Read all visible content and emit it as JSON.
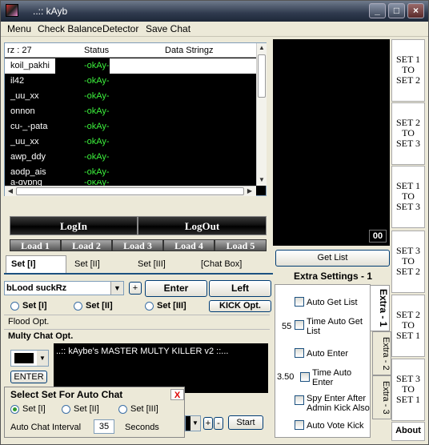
{
  "window": {
    "title": "..:: kAyb"
  },
  "menu": [
    "Menu",
    "Check Balance",
    "Detector",
    "Save Chat"
  ],
  "list": {
    "headers": {
      "count": "rz : 27",
      "status": "Status",
      "data": "Data Stringz"
    },
    "rows": [
      {
        "name": "koil_pakhi",
        "status": "-okAy-"
      },
      {
        "name": "il42",
        "status": "-okAy-"
      },
      {
        "name": "_uu_xx",
        "status": "-okAy-"
      },
      {
        "name": "onnon",
        "status": "-okAy-"
      },
      {
        "name": "cu-_-pata",
        "status": "-okAy-"
      },
      {
        "name": "_uu_xx",
        "status": "-okAy-"
      },
      {
        "name": "awp_ddy",
        "status": "-okAy-"
      },
      {
        "name": "aodp_ais",
        "status": "-okAy-"
      },
      {
        "name": "a-dvbnq",
        "status": "-okAy-"
      }
    ]
  },
  "buttons": {
    "login": "LogIn",
    "logout": "LogOut",
    "enter": "Enter",
    "left": "Left",
    "kick": "KICK Opt.",
    "get_list": "Get List",
    "start": "Start",
    "enter_small": "ENTER",
    "about": "About"
  },
  "loads": [
    "Load 1",
    "Load 2",
    "Load 3",
    "Load 4",
    "Load 5"
  ],
  "set_tabs": [
    "Set [I]",
    "Set [II]",
    "Set [III]",
    "[Chat Box]"
  ],
  "room": {
    "value": "bLood suckRz"
  },
  "set_radios": [
    "Set [I]",
    "Set [II]",
    "Set [III]"
  ],
  "flood_label": "Flood Opt.",
  "multy_label": "Multy Chat Opt.",
  "chat_text": "..:: kAybe's MASTER MULTY KILLER v2 ::...",
  "monitor_counter": "00",
  "extra": {
    "title": "Extra Settings - 1",
    "auto_get_list": "Auto Get List",
    "time_get_list_value": "55",
    "time_get_list": "Time Auto Get List",
    "auto_enter": "Auto Enter",
    "time_enter_value": "3.50",
    "time_enter": "Time  Auto Enter",
    "spy_enter": "Spy Enter After Admin Kick Also",
    "auto_vote": "Auto Vote Kick",
    "tabs": [
      "Extra - 1",
      "Extra - 2",
      "Extra - 3"
    ]
  },
  "sets": [
    "SET 1\nTO\nSET 2",
    "SET 2\nTO\nSET 3",
    "SET 1\nTO\nSET 3",
    "SET 3\nTO\nSET 2",
    "SET 2\nTO\nSET 1",
    "SET 3\nTO\nSET 1"
  ],
  "popup": {
    "title": "Select Set For Auto Chat",
    "close": "X",
    "options": [
      "Set [I]",
      "Set [II]",
      "Set [III]"
    ],
    "interval_label": "Auto Chat Interval",
    "interval_value": "35",
    "seconds_label": "Seconds"
  }
}
